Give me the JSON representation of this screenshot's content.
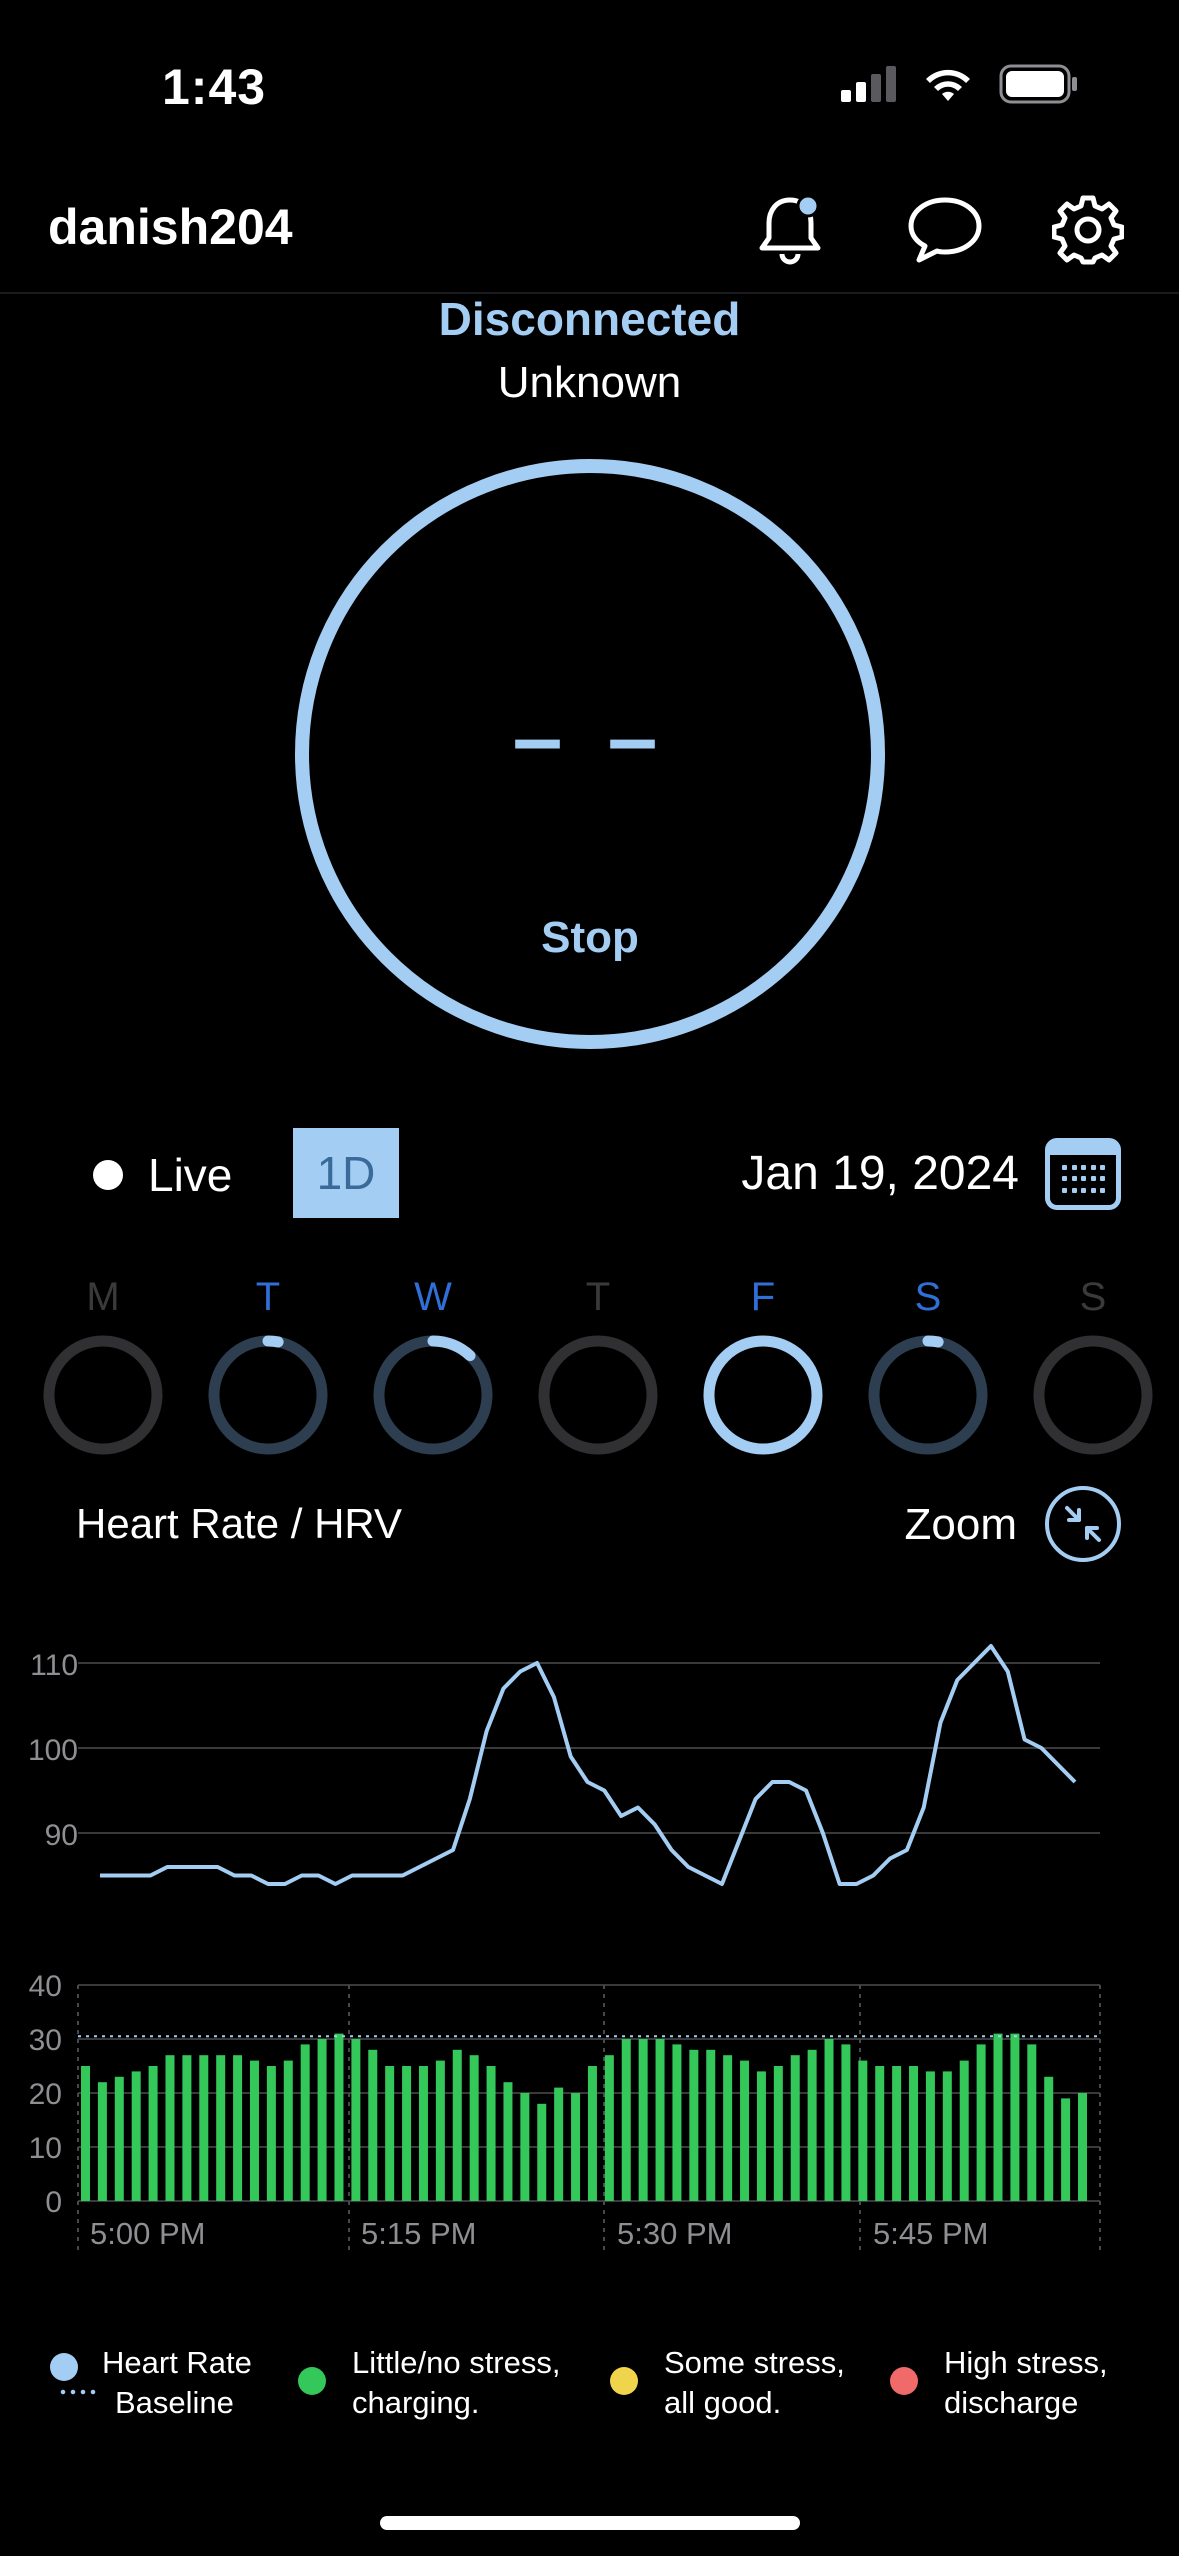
{
  "status_bar": {
    "time": "1:43"
  },
  "header": {
    "username": "danish204"
  },
  "connection": {
    "status": "Disconnected",
    "substatus": "Unknown"
  },
  "ring": {
    "value": "– –",
    "action": "Stop"
  },
  "controls": {
    "live_label": "Live",
    "range_label": "1D",
    "date": "Jan 19, 2024"
  },
  "week": [
    {
      "letter": "M",
      "color": "#3a3a3c",
      "progress": 0,
      "active": false
    },
    {
      "letter": "T",
      "color": "#2f6fd6",
      "progress": 0.03,
      "active": false
    },
    {
      "letter": "W",
      "color": "#2f6fd6",
      "progress": 0.12,
      "active": false
    },
    {
      "letter": "T",
      "color": "#3a3a3c",
      "progress": 0,
      "active": false
    },
    {
      "letter": "F",
      "color": "#2f6fd6",
      "progress": 1.0,
      "active": true
    },
    {
      "letter": "S",
      "color": "#2f6fd6",
      "progress": 0.03,
      "active": false
    },
    {
      "letter": "S",
      "color": "#3a3a3c",
      "progress": 0,
      "active": false
    }
  ],
  "chart_section": {
    "title": "Heart Rate / HRV",
    "zoom_label": "Zoom"
  },
  "chart_data": [
    {
      "type": "line",
      "series": [
        {
          "values": [
            85,
            85,
            85,
            85,
            86,
            86,
            86,
            86,
            85,
            85,
            84,
            84,
            85,
            85,
            84,
            85,
            85,
            85,
            85,
            86,
            87,
            88,
            94,
            102,
            107,
            109,
            110,
            106,
            99,
            96,
            95,
            92,
            93,
            91,
            88,
            86,
            85,
            84,
            89,
            94,
            96,
            96,
            95,
            90,
            84,
            84,
            85,
            87,
            88,
            93,
            103,
            108,
            110,
            112,
            109,
            101,
            100,
            98,
            96
          ]
        }
      ],
      "y_ticks": [
        "110",
        "100",
        "90"
      ],
      "ylim": [
        80,
        115
      ],
      "color": "#a3cdf2"
    },
    {
      "type": "bar",
      "series": [
        {
          "values": [
            25,
            22,
            23,
            24,
            25,
            27,
            27,
            27,
            27,
            27,
            26,
            25,
            26,
            29,
            30,
            31,
            30,
            28,
            25,
            25,
            25,
            26,
            28,
            27,
            25,
            22,
            20,
            18,
            21,
            20,
            25,
            27,
            30,
            30,
            30,
            29,
            28,
            28,
            27,
            26,
            24,
            25,
            27,
            28,
            30,
            29,
            26,
            25,
            25,
            25,
            24,
            24,
            26,
            29,
            31,
            31,
            29,
            23,
            19,
            20
          ]
        }
      ],
      "y_ticks": [
        "40",
        "30",
        "20",
        "10",
        "0"
      ],
      "ylim": [
        0,
        40
      ],
      "baseline": 30.5,
      "categories": [
        "5:00 PM",
        "5:15 PM",
        "5:30 PM",
        "5:45 PM"
      ],
      "color": "#34c759"
    }
  ],
  "legend": [
    {
      "line1": "Heart Rate",
      "line2": "Baseline",
      "color": "#a3cdf2"
    },
    {
      "line1": "Little/no stress,",
      "line2": "charging.",
      "color": "#34c759"
    },
    {
      "line1": "Some stress,",
      "line2": "all good.",
      "color": "#f0d44c"
    },
    {
      "line1": "High stress,",
      "line2": "discharge",
      "color": "#f06a6a"
    }
  ]
}
